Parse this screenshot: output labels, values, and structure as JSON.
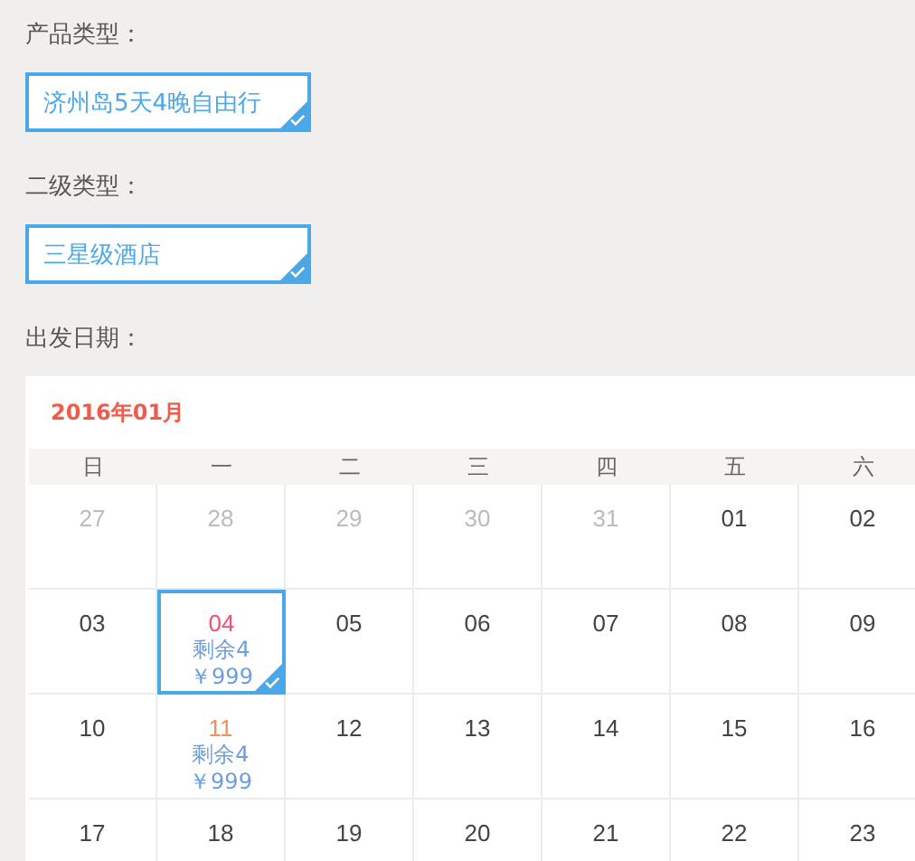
{
  "fields": [
    {
      "label": "产品类型：",
      "value": "济州岛5天4晚自由行",
      "selected": true
    },
    {
      "label": "二级类型：",
      "value": "三星级酒店",
      "selected": true
    }
  ],
  "date_label": "出发日期：",
  "calendar": {
    "month": "2016年01月",
    "weekdays": [
      "日",
      "一",
      "二",
      "三",
      "四",
      "五",
      "六"
    ],
    "weeks": [
      [
        {
          "day": "27",
          "muted": true
        },
        {
          "day": "28",
          "muted": true
        },
        {
          "day": "29",
          "muted": true
        },
        {
          "day": "30",
          "muted": true
        },
        {
          "day": "31",
          "muted": true
        },
        {
          "day": "01",
          "muted": false
        },
        {
          "day": "02",
          "muted": false
        }
      ],
      [
        {
          "day": "03",
          "muted": false
        },
        {
          "day": "04",
          "muted": false,
          "selected": true,
          "remaining": "剩余4",
          "price": "￥999"
        },
        {
          "day": "05",
          "muted": false
        },
        {
          "day": "06",
          "muted": false
        },
        {
          "day": "07",
          "muted": false
        },
        {
          "day": "08",
          "muted": false
        },
        {
          "day": "09",
          "muted": false
        }
      ],
      [
        {
          "day": "10",
          "muted": false
        },
        {
          "day": "11",
          "muted": false,
          "selected": false,
          "remaining": "剩余4",
          "price": "￥999"
        },
        {
          "day": "12",
          "muted": false
        },
        {
          "day": "13",
          "muted": false
        },
        {
          "day": "14",
          "muted": false
        },
        {
          "day": "15",
          "muted": false
        },
        {
          "day": "16",
          "muted": false
        }
      ],
      [
        {
          "day": "17",
          "muted": false
        },
        {
          "day": "18",
          "muted": false
        },
        {
          "day": "19",
          "muted": false
        },
        {
          "day": "20",
          "muted": false
        },
        {
          "day": "21",
          "muted": false
        },
        {
          "day": "22",
          "muted": false
        },
        {
          "day": "23",
          "muted": false
        }
      ]
    ]
  }
}
